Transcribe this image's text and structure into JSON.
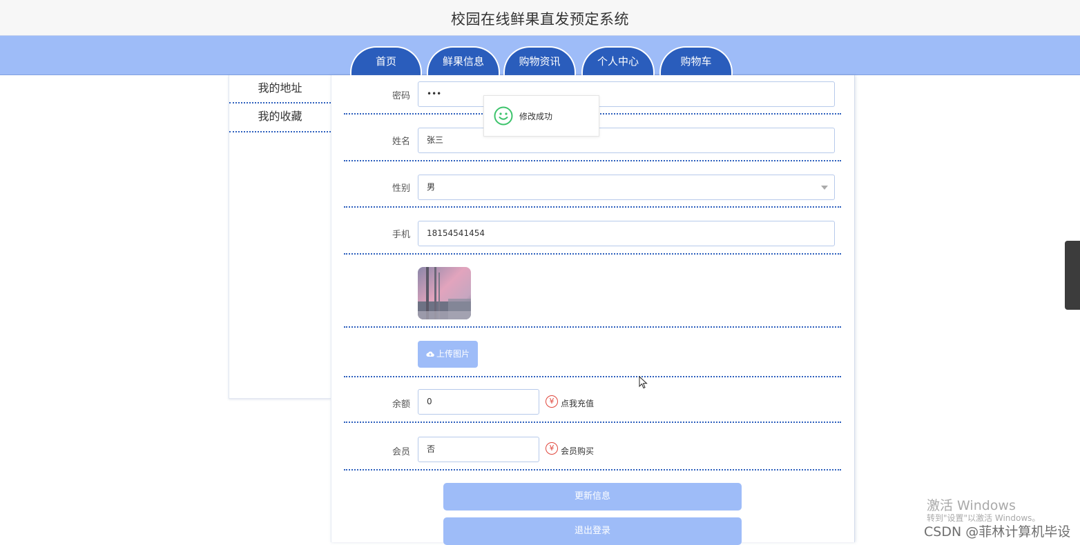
{
  "header": {
    "title": "校园在线鲜果直发预定系统"
  },
  "nav": {
    "tabs": [
      {
        "label": "首页"
      },
      {
        "label": "鲜果信息"
      },
      {
        "label": "购物资讯"
      },
      {
        "label": "个人中心"
      },
      {
        "label": "购物车"
      }
    ]
  },
  "sidebar": {
    "items": [
      {
        "label": "我的地址"
      },
      {
        "label": "我的收藏"
      }
    ]
  },
  "form": {
    "password": {
      "label": "密码",
      "value": "•••"
    },
    "name": {
      "label": "姓名",
      "value": "张三"
    },
    "gender": {
      "label": "性别",
      "value": "男"
    },
    "phone": {
      "label": "手机",
      "value": "18154541454"
    },
    "upload_button": "上传图片",
    "balance": {
      "label": "余额",
      "value": "0",
      "action": "点我充值"
    },
    "member": {
      "label": "会员",
      "value": "否",
      "action": "会员购买"
    },
    "update_button": "更新信息",
    "logout_button": "退出登录"
  },
  "toast": {
    "message": "修改成功"
  },
  "icons": {
    "smile": "smile-icon",
    "upload": "cloud-upload-icon",
    "yen": "yen-icon"
  },
  "colors": {
    "nav_bar": "#9ebcf8",
    "tab": "#2a5dbc",
    "button": "#9ebcf8",
    "toast_icon": "#3cc36b",
    "yen": "#e0453b"
  },
  "watermark": {
    "activate_title": "激活 Windows",
    "activate_sub": "转到\"设置\"以激活 Windows。",
    "csdn": "CSDN @菲林计算机毕设"
  }
}
